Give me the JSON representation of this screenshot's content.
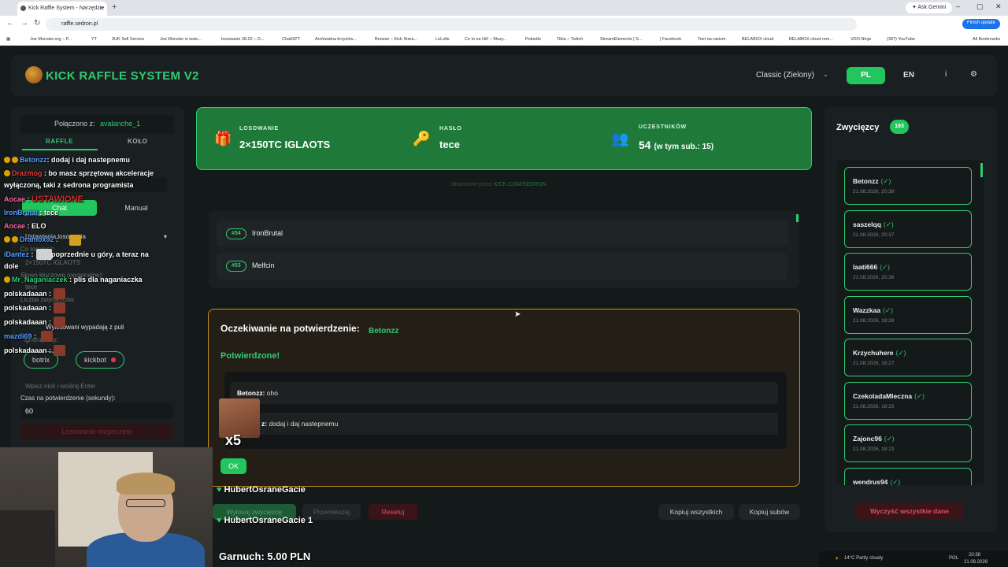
{
  "browser": {
    "tab_title": "Kick Raffle System - Narzędzie",
    "new_tab": "+",
    "ask_gemini": "✦ Ask Gemini",
    "url": "raffle.sedron.pl",
    "finish_update": "Finish update",
    "bookmarks": [
      "Joe Monster.org – P...",
      "YT",
      "3UK Sell Service",
      "Joe Monster is watc...",
      "losowanie 28.02 – D...",
      "ChatGPT",
      "Archiwalna krzyżów...",
      "Browse – Kick Strea...",
      "LoLolle",
      "Co to za Hit! – Muzy...",
      "Pokedle",
      "Tibia – Twitch",
      "StreamElements | S...",
      "| Facebook",
      "Text na rasizm",
      "BELABOX cloud",
      "BELABOX cloud rem...",
      "VDO.Ninja",
      "(387) YouTube"
    ],
    "all_bookmarks": "All Bookmarks"
  },
  "header": {
    "title": "KICK RAFFLE SYSTEM V2",
    "theme": "Classic (Zielony)",
    "lang_pl": "PL",
    "lang_en": "EN",
    "info_icon": "i",
    "settings_icon": "⚙"
  },
  "left": {
    "connected_label": "Połączono z:",
    "connected_user": "avalanche_1",
    "tab_raffle": "RAFFLE",
    "tab_wheel": "KOŁO",
    "mode_chat": "Chat",
    "mode_manual": "Manual",
    "settings_label": "Ustawienia losowania",
    "raffle_name_label": "Co losujesz:",
    "raffle_name_value": "2×150TC IGLAOTS",
    "keyword_label": "Słowo kluczowe (opcjonalne):",
    "keyword_value": "tece",
    "winners_count_label": "Liczba zwycięzców:",
    "winners_left_label": "Wylosowani wypadają z puli",
    "ignored_label": "Ignoruj boty:",
    "bots": [
      "botrix",
      "kickbot"
    ],
    "nick_placeholder": "Wpisz nick i wciśnij Enter",
    "timeout_label": "Czas na potwierdzenie (sekundy):",
    "timeout_value": "60",
    "start_button": "Losowanie rozpoczęte"
  },
  "overlay_chat": [
    {
      "user": "Betonzz",
      "text": "dodaj i daj nastepnemu",
      "color": "#5aa0ff"
    },
    {
      "user": "Drazmog",
      "text": "bo masz sprzętową akceleracje",
      "color": "#e0403a"
    },
    {
      "user": "",
      "text": "wyłączoną, taki z sedrona programista",
      "color": "#fff"
    },
    {
      "user": "Aocae",
      "text": "",
      "color": "#ff66aa"
    },
    {
      "user": "IronBrutal",
      "text": "tece",
      "color": "#5aa0ff"
    },
    {
      "user": "Aocae",
      "text": "ELO",
      "color": "#ff66aa"
    },
    {
      "user": "Dramox92",
      "text": "",
      "color": "#5aa0ff"
    },
    {
      "user": "iDantez",
      "text": "poprzednie u góry, a teraz na",
      "color": "#5aa0ff"
    },
    {
      "user": "",
      "text": "dole",
      "color": "#fff"
    },
    {
      "user": "Mr_Naganiaczek",
      "text": "plis dla naganiaczka",
      "color": "#2ecc71"
    },
    {
      "user": "polskadaaan",
      "text": "",
      "color": "#fff"
    },
    {
      "user": "polskadaaan",
      "text": "",
      "color": "#fff"
    },
    {
      "user": "polskadaaan",
      "text": "",
      "color": "#fff"
    },
    {
      "user": "mazdi69",
      "text": "",
      "color": "#5aa0ff"
    },
    {
      "user": "polskadaaan",
      "text": "",
      "color": "#fff"
    }
  ],
  "overlay_sep": ":",
  "overlay_red_banner": "USTAWIONE",
  "info": {
    "raffle_label": "LOSOWANIE",
    "raffle_value": "2×150TC IGLAOTS",
    "password_label": "HASŁO",
    "password_value": "tece",
    "participants_label": "UCZESTNIKÓW",
    "participants_value": "54",
    "participants_sub": "(w tym sub.: 15)"
  },
  "created_by": "Stworzone przez",
  "created_by_link": "KICK.COM/SEDRON",
  "entries": [
    {
      "num": "#54",
      "name": "IronBrutal"
    },
    {
      "num": "#53",
      "name": "Melfcin"
    }
  ],
  "confirm": {
    "title": "Oczekiwanie na potwierdzenie:",
    "winner": "Betonzz",
    "confirmed": "Potwierdzone!",
    "messages": [
      {
        "user": "Betonzz:",
        "text": "oho"
      },
      {
        "user": "z:",
        "text": "dodaj i daj nastepnemu"
      }
    ],
    "ok_button": "OK",
    "x5": "x5"
  },
  "bottom": {
    "draw_winner": "Wylosuj zwycięzcę",
    "shuffle": "Przemieszaj",
    "reset": "Resetuj",
    "copy_all": "Kopiuj wszystkich",
    "copy_subs": "Kopiuj subów"
  },
  "winners": {
    "title": "Zwycięzcy",
    "count": "193",
    "list": [
      {
        "name": "Betonzz",
        "check": "(✓)",
        "date": "21.08.2026, 20:38"
      },
      {
        "name": "saszelqq",
        "check": "(✓)",
        "date": "21.08.2026, 20:37"
      },
      {
        "name": "laati666",
        "check": "(✓)",
        "date": "21.08.2026, 20:36"
      },
      {
        "name": "Wazzkaa",
        "check": "(✓)",
        "date": "21.08.2026, 18:28"
      },
      {
        "name": "Krzychuhere",
        "check": "(✓)",
        "date": "21.08.2026, 18:27"
      },
      {
        "name": "CzekoladaMleczna",
        "check": "(✓)",
        "date": "21.08.2026, 18:25"
      },
      {
        "name": "Zajonc96",
        "check": "(✓)",
        "date": "21.08.2026, 18:23"
      },
      {
        "name": "wendrus94",
        "check": "(✓)",
        "date": ""
      }
    ],
    "wipe_button": "Wyczyść wszystkie dane"
  },
  "stream_overlay": {
    "hubert1": "HubertOsraneGacie",
    "hubert2": "HubertOsraneGacie 1",
    "garnuch": "Garnuch: 5.00 PLN"
  },
  "tray": {
    "weather": "14°C Partly cloudy",
    "lang": "POL",
    "time": "20:38",
    "date": "21.08.2026"
  },
  "colors": {
    "accent": "#2ecc71",
    "background": "#14191a",
    "panel": "#1a2021",
    "modal_border": "#c7921a",
    "danger": "#e05060"
  }
}
